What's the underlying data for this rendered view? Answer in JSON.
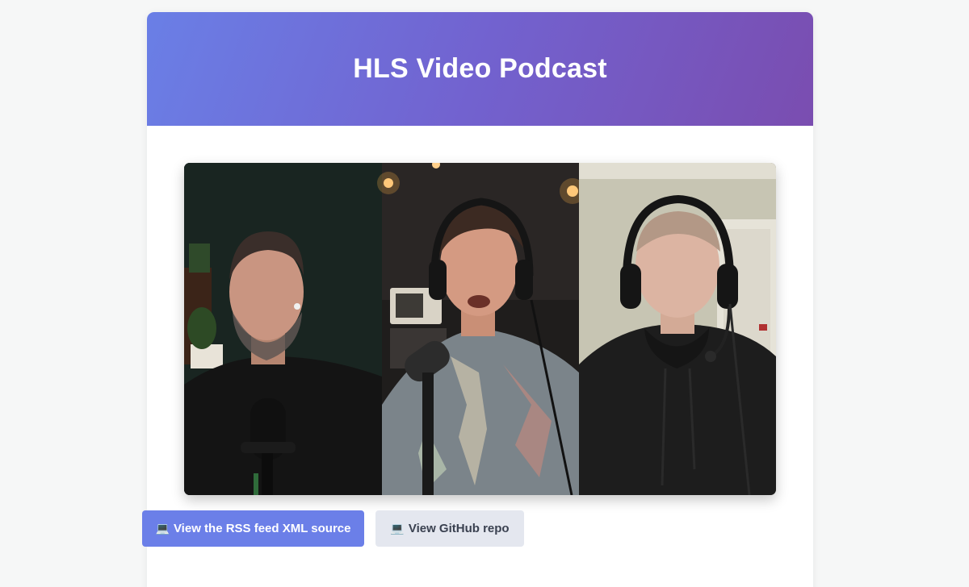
{
  "header": {
    "title": "HLS Video Podcast"
  },
  "player": {
    "participants": 3
  },
  "actions": {
    "rss": {
      "icon": "computer-icon",
      "glyph": "💻",
      "label": "View the RSS feed XML source"
    },
    "github": {
      "icon": "laptop-icon",
      "glyph": "💻",
      "label": "View GitHub repo"
    }
  },
  "colors": {
    "header_start": "#6a7fe6",
    "header_end": "#7a4db0",
    "primary_button": "#6b7fe8",
    "secondary_button": "#e4e7ef",
    "page_bg": "#f6f7f7"
  }
}
